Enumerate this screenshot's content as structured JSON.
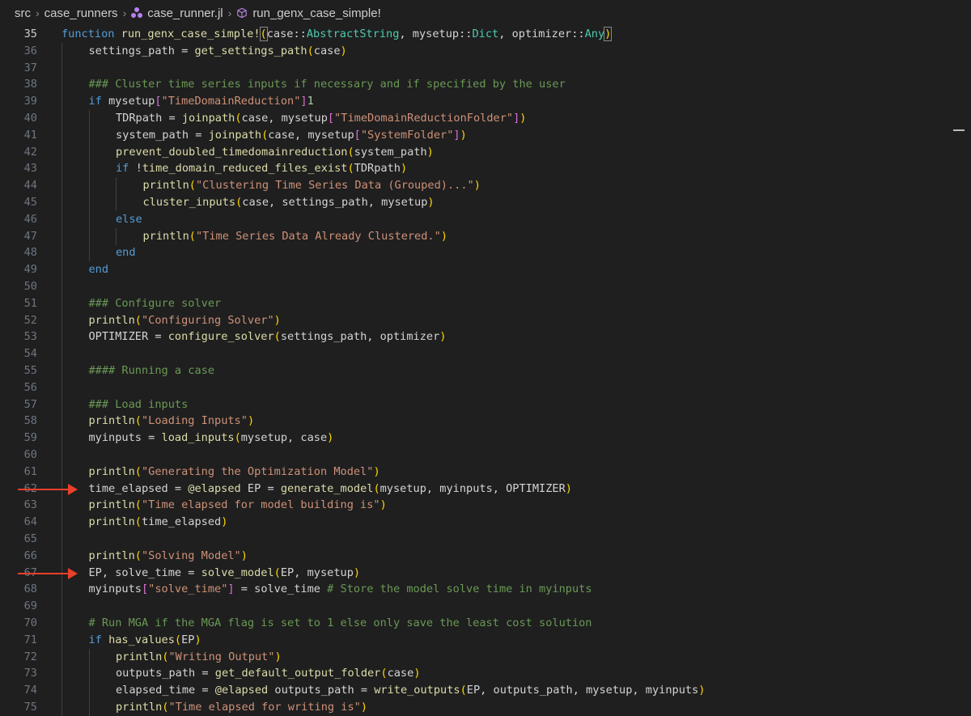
{
  "breadcrumb": {
    "folder1": "src",
    "folder2": "case_runners",
    "file": "case_runner.jl",
    "symbol": "run_genx_case_simple!"
  },
  "lines": [
    {
      "n": "35",
      "indent": 0,
      "t": [
        [
          "kw",
          "function "
        ],
        [
          "fn",
          "run_genx_case_simple!"
        ],
        [
          "brbox",
          "("
        ],
        [
          "",
          "case::"
        ],
        [
          "ty",
          "AbstractString"
        ],
        [
          "",
          ", mysetup::"
        ],
        [
          "ty",
          "Dict"
        ],
        [
          "",
          ", optimizer::"
        ],
        [
          "ty",
          "Any"
        ],
        [
          "brbox",
          ")"
        ]
      ]
    },
    {
      "n": "36",
      "indent": 1,
      "t": [
        [
          "",
          "settings_path = "
        ],
        [
          "fn",
          "get_settings_path"
        ],
        [
          "br",
          "("
        ],
        [
          "",
          "case"
        ],
        [
          "br",
          ")"
        ]
      ]
    },
    {
      "n": "37",
      "indent": 0,
      "t": []
    },
    {
      "n": "38",
      "indent": 1,
      "t": [
        [
          "cm",
          "### Cluster time series inputs if necessary and if specified by the user"
        ]
      ]
    },
    {
      "n": "39",
      "indent": 1,
      "t": [
        [
          "kw",
          "if "
        ],
        [
          "",
          "mysetup"
        ],
        [
          "br2",
          "["
        ],
        [
          "str",
          "\"TimeDomainReduction\""
        ],
        [
          "br2",
          "]"
        ],
        [
          "",
          "",
          " == "
        ],
        [
          "num",
          "1"
        ]
      ]
    },
    {
      "n": "40",
      "indent": 2,
      "t": [
        [
          "",
          "TDRpath = "
        ],
        [
          "fn",
          "joinpath"
        ],
        [
          "br",
          "("
        ],
        [
          "",
          "case, mysetup"
        ],
        [
          "br2",
          "["
        ],
        [
          "str",
          "\"TimeDomainReductionFolder\""
        ],
        [
          "br2",
          "]"
        ],
        [
          "br",
          ")"
        ]
      ]
    },
    {
      "n": "41",
      "indent": 2,
      "t": [
        [
          "",
          "system_path = "
        ],
        [
          "fn",
          "joinpath"
        ],
        [
          "br",
          "("
        ],
        [
          "",
          "case, mysetup"
        ],
        [
          "br2",
          "["
        ],
        [
          "str",
          "\"SystemFolder\""
        ],
        [
          "br2",
          "]"
        ],
        [
          "br",
          ")"
        ]
      ]
    },
    {
      "n": "42",
      "indent": 2,
      "t": [
        [
          "fn",
          "prevent_doubled_timedomainreduction"
        ],
        [
          "br",
          "("
        ],
        [
          "",
          "system_path"
        ],
        [
          "br",
          ")"
        ]
      ]
    },
    {
      "n": "43",
      "indent": 2,
      "t": [
        [
          "kw",
          "if "
        ],
        [
          "",
          "!"
        ],
        [
          "fn",
          "time_domain_reduced_files_exist"
        ],
        [
          "br",
          "("
        ],
        [
          "",
          "TDRpath"
        ],
        [
          "br",
          ")"
        ]
      ]
    },
    {
      "n": "44",
      "indent": 3,
      "t": [
        [
          "fn",
          "println"
        ],
        [
          "br",
          "("
        ],
        [
          "str",
          "\"Clustering Time Series Data (Grouped)...\""
        ],
        [
          "br",
          ")"
        ]
      ]
    },
    {
      "n": "45",
      "indent": 3,
      "t": [
        [
          "fn",
          "cluster_inputs"
        ],
        [
          "br",
          "("
        ],
        [
          "",
          "case, settings_path, mysetup"
        ],
        [
          "br",
          ")"
        ]
      ]
    },
    {
      "n": "46",
      "indent": 2,
      "t": [
        [
          "kw",
          "else"
        ]
      ]
    },
    {
      "n": "47",
      "indent": 3,
      "t": [
        [
          "fn",
          "println"
        ],
        [
          "br",
          "("
        ],
        [
          "str",
          "\"Time Series Data Already Clustered.\""
        ],
        [
          "br",
          ")"
        ]
      ]
    },
    {
      "n": "48",
      "indent": 2,
      "t": [
        [
          "kw",
          "end"
        ]
      ]
    },
    {
      "n": "49",
      "indent": 1,
      "t": [
        [
          "kw",
          "end"
        ]
      ]
    },
    {
      "n": "50",
      "indent": 0,
      "t": []
    },
    {
      "n": "51",
      "indent": 1,
      "t": [
        [
          "cm",
          "### Configure solver"
        ]
      ]
    },
    {
      "n": "52",
      "indent": 1,
      "t": [
        [
          "fn",
          "println"
        ],
        [
          "br",
          "("
        ],
        [
          "str",
          "\"Configuring Solver\""
        ],
        [
          "br",
          ")"
        ]
      ]
    },
    {
      "n": "53",
      "indent": 1,
      "t": [
        [
          "",
          "OPTIMIZER = "
        ],
        [
          "fn",
          "configure_solver"
        ],
        [
          "br",
          "("
        ],
        [
          "",
          "settings_path, optimizer"
        ],
        [
          "br",
          ")"
        ]
      ]
    },
    {
      "n": "54",
      "indent": 0,
      "t": []
    },
    {
      "n": "55",
      "indent": 1,
      "t": [
        [
          "cm",
          "#### Running a case"
        ]
      ]
    },
    {
      "n": "56",
      "indent": 0,
      "t": []
    },
    {
      "n": "57",
      "indent": 1,
      "t": [
        [
          "cm",
          "### Load inputs"
        ]
      ]
    },
    {
      "n": "58",
      "indent": 1,
      "t": [
        [
          "fn",
          "println"
        ],
        [
          "br",
          "("
        ],
        [
          "str",
          "\"Loading Inputs\""
        ],
        [
          "br",
          ")"
        ]
      ]
    },
    {
      "n": "59",
      "indent": 1,
      "t": [
        [
          "",
          "myinputs = "
        ],
        [
          "fn",
          "load_inputs"
        ],
        [
          "br",
          "("
        ],
        [
          "",
          "mysetup, case"
        ],
        [
          "br",
          ")"
        ]
      ]
    },
    {
      "n": "60",
      "indent": 0,
      "t": []
    },
    {
      "n": "61",
      "indent": 1,
      "t": [
        [
          "fn",
          "println"
        ],
        [
          "br",
          "("
        ],
        [
          "str",
          "\"Generating the Optimization Model\""
        ],
        [
          "br",
          ")"
        ]
      ]
    },
    {
      "n": "62",
      "indent": 1,
      "t": [
        [
          "",
          "time_elapsed = "
        ],
        [
          "mac",
          "@elapsed"
        ],
        [
          "",
          " EP = "
        ],
        [
          "fn",
          "generate_model"
        ],
        [
          "br",
          "("
        ],
        [
          "",
          "mysetup, myinputs, OPTIMIZER"
        ],
        [
          "br",
          ")"
        ]
      ]
    },
    {
      "n": "63",
      "indent": 1,
      "t": [
        [
          "fn",
          "println"
        ],
        [
          "br",
          "("
        ],
        [
          "str",
          "\"Time elapsed for model building is\""
        ],
        [
          "br",
          ")"
        ]
      ]
    },
    {
      "n": "64",
      "indent": 1,
      "t": [
        [
          "fn",
          "println"
        ],
        [
          "br",
          "("
        ],
        [
          "",
          "time_elapsed"
        ],
        [
          "br",
          ")"
        ]
      ]
    },
    {
      "n": "65",
      "indent": 0,
      "t": []
    },
    {
      "n": "66",
      "indent": 1,
      "t": [
        [
          "fn",
          "println"
        ],
        [
          "br",
          "("
        ],
        [
          "str",
          "\"Solving Model\""
        ],
        [
          "br",
          ")"
        ]
      ]
    },
    {
      "n": "67",
      "indent": 1,
      "t": [
        [
          "",
          "EP, solve_time = "
        ],
        [
          "fn",
          "solve_model"
        ],
        [
          "br",
          "("
        ],
        [
          "",
          "EP, mysetup"
        ],
        [
          "br",
          ")"
        ]
      ]
    },
    {
      "n": "68",
      "indent": 1,
      "t": [
        [
          "",
          "myinputs"
        ],
        [
          "br2",
          "["
        ],
        [
          "str",
          "\"solve_time\""
        ],
        [
          "br2",
          "]"
        ],
        [
          "",
          " = solve_time "
        ],
        [
          "cm",
          "# Store the model solve time in myinputs"
        ]
      ]
    },
    {
      "n": "69",
      "indent": 0,
      "t": []
    },
    {
      "n": "70",
      "indent": 1,
      "t": [
        [
          "cm",
          "# Run MGA if the MGA flag is set to 1 else only save the least cost solution"
        ]
      ]
    },
    {
      "n": "71",
      "indent": 1,
      "t": [
        [
          "kw",
          "if "
        ],
        [
          "fn",
          "has_values"
        ],
        [
          "br",
          "("
        ],
        [
          "",
          "EP"
        ],
        [
          "br",
          ")"
        ]
      ]
    },
    {
      "n": "72",
      "indent": 2,
      "t": [
        [
          "fn",
          "println"
        ],
        [
          "br",
          "("
        ],
        [
          "str",
          "\"Writing Output\""
        ],
        [
          "br",
          ")"
        ]
      ]
    },
    {
      "n": "73",
      "indent": 2,
      "t": [
        [
          "",
          "outputs_path = "
        ],
        [
          "fn",
          "get_default_output_folder"
        ],
        [
          "br",
          "("
        ],
        [
          "",
          "case"
        ],
        [
          "br",
          ")"
        ]
      ]
    },
    {
      "n": "74",
      "indent": 2,
      "t": [
        [
          "",
          "elapsed_time = "
        ],
        [
          "mac",
          "@elapsed"
        ],
        [
          "",
          " outputs_path = "
        ],
        [
          "fn",
          "write_outputs"
        ],
        [
          "br",
          "("
        ],
        [
          "",
          "EP, outputs_path, mysetup, myinputs"
        ],
        [
          "br",
          ")"
        ]
      ]
    },
    {
      "n": "75",
      "indent": 2,
      "t": [
        [
          "fn",
          "println"
        ],
        [
          "br",
          "("
        ],
        [
          "str",
          "\"Time elapsed for writing is\""
        ],
        [
          "br",
          ")"
        ]
      ]
    }
  ],
  "active_line": "35",
  "annotations": [
    {
      "line": "62"
    },
    {
      "line": "67"
    }
  ],
  "colors": {
    "background": "#1f1f1f",
    "keyword": "#569cd6",
    "function": "#dcdcaa",
    "string": "#ce9178",
    "comment": "#6a9955",
    "type": "#4ec9b0",
    "arrow": "#e8402a"
  },
  "icons": [
    "chevron-right-icon",
    "julia-file-icon",
    "symbol-method-icon"
  ]
}
